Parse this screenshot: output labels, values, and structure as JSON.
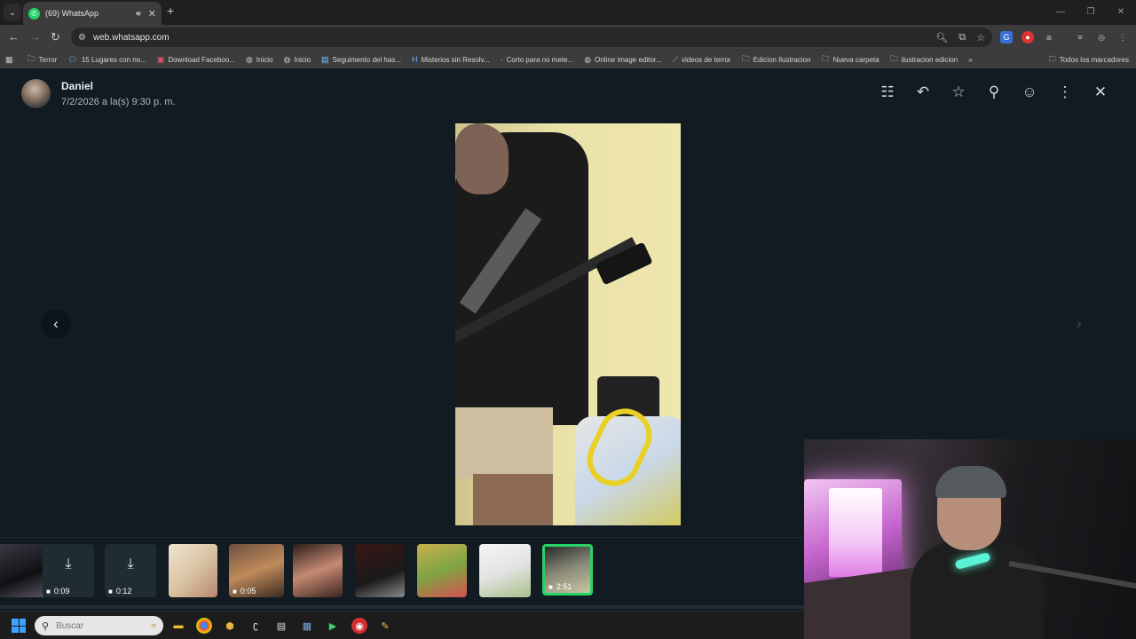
{
  "browser": {
    "tab_title": "(69) WhatsApp",
    "url": "web.whatsapp.com",
    "bookmarks": [
      "Terror",
      "15 Lugares con no...",
      "Download Faceboo...",
      "Inicio",
      "Inicio",
      "Seguimento del has...",
      "Misterios sin Resolv...",
      "Corto para no mete...",
      "Online image editor...",
      "videos de terror",
      "Edicion Ilustracion",
      "Nueva carpeta",
      "ilustracion edicion"
    ],
    "bookmarks_more": "»",
    "all_bookmarks": "Todos los marcadores"
  },
  "viewer": {
    "sender_name": "Daniel",
    "sent_time": "7/2/2026 a la(s) 9:30 p. m.",
    "thumbnails": [
      {
        "kind": "video",
        "duration": ""
      },
      {
        "kind": "download-video",
        "duration": "0:09"
      },
      {
        "kind": "download-video",
        "duration": "0:12"
      },
      {
        "kind": "image",
        "duration": ""
      },
      {
        "kind": "video",
        "duration": "0:05"
      },
      {
        "kind": "image",
        "duration": ""
      },
      {
        "kind": "image",
        "duration": ""
      },
      {
        "kind": "image",
        "duration": ""
      },
      {
        "kind": "image",
        "duration": ""
      },
      {
        "kind": "video",
        "duration": "2:51"
      }
    ],
    "accent_color": "#25d366"
  },
  "taskbar": {
    "search_placeholder": "Buscar"
  }
}
